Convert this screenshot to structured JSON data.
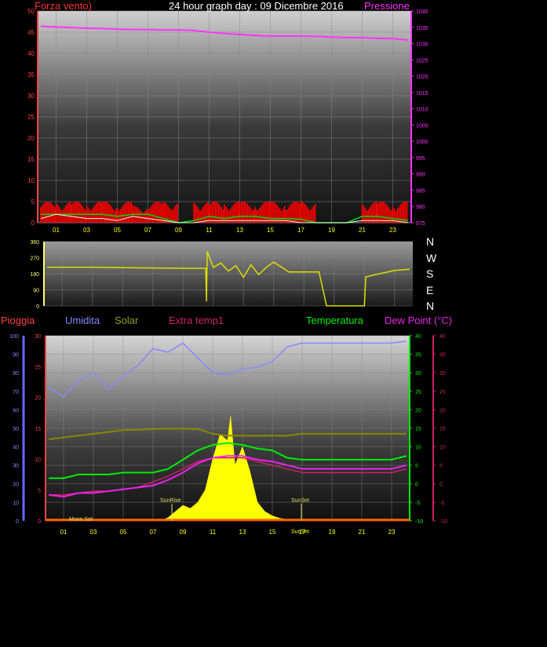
{
  "top": {
    "left_title": "Forza vento)",
    "center_title": "24 hour graph day : 09 Dicembre 2016",
    "right_title": "Pressione",
    "left_ticks": [
      "50",
      "45",
      "40",
      "35",
      "30",
      "25",
      "20",
      "15",
      "10",
      "5",
      "0"
    ],
    "right_ticks": [
      "1040",
      "1035",
      "1030",
      "1025",
      "1020",
      "1015",
      "1010",
      "1005",
      "1000",
      "995",
      "990",
      "985",
      "980",
      "975"
    ],
    "x_ticks": [
      "01",
      "03",
      "05",
      "07",
      "09",
      "11",
      "13",
      "15",
      "17",
      "19",
      "21",
      "23"
    ]
  },
  "mid": {
    "left_ticks": [
      "360",
      "270",
      "180",
      "90",
      "0"
    ],
    "compass": [
      "N",
      "W",
      "S",
      "E",
      "N"
    ]
  },
  "bottom": {
    "legend": {
      "pioggia": "Pioggia",
      "umidita": "Umidita",
      "solar": "Solar",
      "extratemp": "Extra temp1",
      "temperatura": "Temperatura",
      "dewpoint": "Dew Point (°C)"
    },
    "humidity_ticks": [
      "100",
      "90",
      "80",
      "70",
      "60",
      "50",
      "40",
      "30",
      "20",
      "10",
      "0"
    ],
    "rain_ticks": [
      "30",
      "25",
      "20",
      "15",
      "10",
      "5",
      "0"
    ],
    "temp_ticks": [
      "40",
      "35",
      "30",
      "25",
      "20",
      "15",
      "10",
      "5",
      "0",
      "-5",
      "-10"
    ],
    "extra_ticks": [
      "40",
      "35",
      "30",
      "25",
      "20",
      "15",
      "10",
      "5",
      "0",
      "-5",
      "-10"
    ],
    "x_ticks": [
      "01",
      "03",
      "05",
      "07",
      "09",
      "11",
      "13",
      "15",
      "17",
      "19",
      "21",
      "23"
    ],
    "annotations": {
      "moonset": "Moon Set",
      "sunrise": "SunRise",
      "sunset_top": "SunSet",
      "sunset_bottom": "SunSet"
    }
  },
  "colors": {
    "wind_gust": "#ff0000",
    "wind_avg": "#00dd00",
    "pressure": "#ff33ff",
    "direction": "#dddd00",
    "humidity": "#8888ff",
    "solar": "#888800",
    "extratemp": "#cc2266",
    "temperature": "#00ee00",
    "dewpoint": "#ee22ee",
    "radiation": "#ffff00",
    "rain": "#ff6600"
  },
  "chart_data": [
    {
      "type": "line",
      "title": "24 hour graph day : 09 Dicembre 2016",
      "xlabel": "",
      "xlim": [
        0,
        24
      ],
      "y_left_label": "Forza vento)",
      "y_left_lim": [
        0,
        50
      ],
      "y_right_label": "Pressione",
      "y_right_lim": [
        975,
        1040
      ],
      "series": [
        {
          "axis": "right",
          "x": [
            0,
            1,
            2,
            3,
            4,
            5,
            6,
            7,
            8,
            9,
            10,
            11,
            12,
            13,
            14,
            15,
            16,
            17,
            18,
            19,
            20,
            21,
            22,
            23,
            24
          ],
          "values": [
            1035.3,
            1035.1,
            1034.9,
            1034.7,
            1034.6,
            1034.4,
            1034.3,
            1034.3,
            1034.2,
            1034.2,
            1034.0,
            1033.5,
            1033.1,
            1032.8,
            1032.5,
            1032.3,
            1032.3,
            1032.3,
            1032.2,
            1032.0,
            1031.8,
            1031.8,
            1031.6,
            1031.5,
            1031.1
          ]
        },
        {
          "axis": "left",
          "x": [
            0,
            1,
            2,
            3,
            4,
            5,
            6,
            7,
            8,
            9,
            10,
            11,
            12,
            13,
            14,
            15,
            16,
            17,
            18,
            19,
            20,
            21,
            22,
            23,
            24
          ],
          "values": [
            5,
            5,
            5,
            5,
            5,
            5,
            4,
            5,
            5,
            0,
            5,
            5,
            5,
            5,
            5,
            5,
            5,
            5,
            0,
            0,
            0,
            5,
            5,
            5,
            5
          ]
        },
        {
          "axis": "left",
          "x": [
            0,
            1,
            2,
            3,
            4,
            5,
            6,
            7,
            8,
            9,
            10,
            11,
            12,
            13,
            14,
            15,
            16,
            17,
            18,
            19,
            20,
            21,
            22,
            23,
            24
          ],
          "values": [
            2,
            2,
            2,
            2,
            2,
            1.5,
            2,
            2,
            1,
            0,
            0.5,
            1.5,
            1,
            1.5,
            1.5,
            1,
            1,
            0.8,
            0,
            0,
            0,
            1.5,
            1.5,
            1,
            0.5
          ]
        },
        {
          "axis": "left",
          "x": [
            0,
            1,
            2,
            3,
            4,
            5,
            6,
            7,
            8,
            9,
            10,
            11,
            12,
            13,
            14,
            15,
            16,
            17,
            18,
            19,
            20,
            21,
            22,
            23,
            24
          ],
          "values": [
            1,
            2,
            1.5,
            1,
            1,
            0.5,
            1.5,
            1,
            0.5,
            0,
            0,
            0.5,
            0.5,
            0.5,
            0.5,
            0.5,
            0.5,
            0,
            0,
            0,
            0,
            0.5,
            0.5,
            0.5,
            0
          ]
        }
      ]
    },
    {
      "type": "line",
      "title": "",
      "xlim": [
        0,
        24
      ],
      "ylim": [
        0,
        360
      ],
      "series": [
        {
          "x": [
            0,
            3,
            6,
            9,
            10.5,
            10.55,
            10.6,
            11,
            11.5,
            12,
            12.5,
            13,
            13.5,
            14,
            14.5,
            15,
            16,
            17,
            18,
            18.5,
            19,
            20,
            21,
            21.1,
            22,
            23,
            24
          ],
          "values": [
            216,
            216,
            213,
            210,
            210,
            25,
            305,
            215,
            240,
            195,
            225,
            160,
            230,
            175,
            215,
            245,
            190,
            190,
            190,
            0,
            0,
            0,
            0,
            162,
            180,
            198,
            205
          ]
        }
      ]
    },
    {
      "type": "line",
      "title": "",
      "xlim": [
        0,
        24
      ],
      "y_humidity_lim": [
        0,
        100
      ],
      "y_rain_lim": [
        0,
        30
      ],
      "y_temp_lim": [
        -10,
        40
      ],
      "series": [
        {
          "x": [
            0,
            1,
            2,
            3,
            4,
            5,
            6,
            7,
            8,
            9,
            10,
            11,
            12,
            13,
            14,
            15,
            16,
            17,
            18,
            19,
            20,
            21,
            22,
            23,
            24
          ],
          "values": [
            72,
            67,
            76,
            80,
            71,
            78,
            84,
            93,
            91,
            96,
            88,
            80,
            79,
            82,
            83,
            86,
            94,
            96,
            96,
            96,
            96,
            96,
            96,
            96,
            97
          ]
        },
        {
          "x": [
            0,
            1,
            2,
            3,
            4,
            5,
            6,
            7,
            8,
            9,
            10,
            11,
            12,
            13,
            14,
            15,
            16,
            17,
            18,
            19,
            20,
            21,
            22,
            23,
            24
          ],
          "values": [
            12,
            12.5,
            13,
            13.5,
            14,
            14.5,
            14.6,
            14.8,
            14.9,
            14.9,
            14.8,
            13.5,
            13,
            13,
            13,
            13,
            13,
            13.5,
            13.5,
            13.5,
            13.5,
            13.5,
            13.5,
            13.5,
            13.5
          ]
        },
        {
          "x": [
            0,
            1,
            2,
            3,
            4,
            5,
            6,
            7,
            8,
            9,
            10,
            11,
            12,
            13,
            14,
            15,
            16,
            17,
            18,
            19,
            20,
            21,
            22,
            23,
            24
          ],
          "values": [
            -3,
            -3,
            -2.5,
            -2,
            -2,
            -1.5,
            -1,
            0.5,
            2,
            4,
            6,
            7,
            7,
            7,
            6,
            5,
            4,
            3,
            3,
            3,
            3,
            3,
            3,
            3,
            4
          ]
        },
        {
          "x": [
            0,
            1,
            2,
            3,
            4,
            5,
            6,
            7,
            8,
            9,
            10,
            11,
            12,
            13,
            14,
            15,
            16,
            17,
            18,
            19,
            20,
            21,
            22,
            23,
            24
          ],
          "values": [
            1.5,
            1.5,
            2.5,
            2.5,
            2.5,
            3,
            3,
            3,
            4,
            6.5,
            9,
            10.5,
            11,
            10.5,
            9.5,
            9,
            7,
            6.5,
            6.5,
            6.5,
            6.5,
            6.5,
            6.5,
            6.5,
            7.5
          ]
        },
        {
          "x": [
            0,
            1,
            2,
            3,
            4,
            5,
            6,
            7,
            8,
            9,
            10,
            11,
            12,
            13,
            14,
            15,
            16,
            17,
            18,
            19,
            20,
            21,
            22,
            23,
            24
          ],
          "values": [
            -3,
            -3.5,
            -2.5,
            -2.5,
            -2,
            -1.5,
            -1,
            -0.5,
            1,
            3,
            5.5,
            7,
            7.5,
            7.5,
            6.5,
            6,
            5,
            4,
            4,
            4,
            4,
            4,
            4,
            4,
            5
          ]
        },
        {
          "x": [
            0,
            7.5,
            8,
            8.5,
            9,
            9.5,
            10,
            10.5,
            11,
            11.5,
            12,
            12.2,
            12.5,
            13,
            13.5,
            14,
            14.5,
            15,
            15.5,
            16,
            16.5,
            24
          ],
          "values": [
            0,
            0,
            0.5,
            1.5,
            2.5,
            2,
            3,
            5,
            10,
            14,
            13,
            17,
            9,
            12,
            8,
            3,
            1.5,
            0.8,
            0.4,
            0.2,
            0,
            0
          ]
        },
        {
          "x": [
            0,
            24
          ],
          "values": [
            0,
            0
          ]
        }
      ]
    }
  ]
}
